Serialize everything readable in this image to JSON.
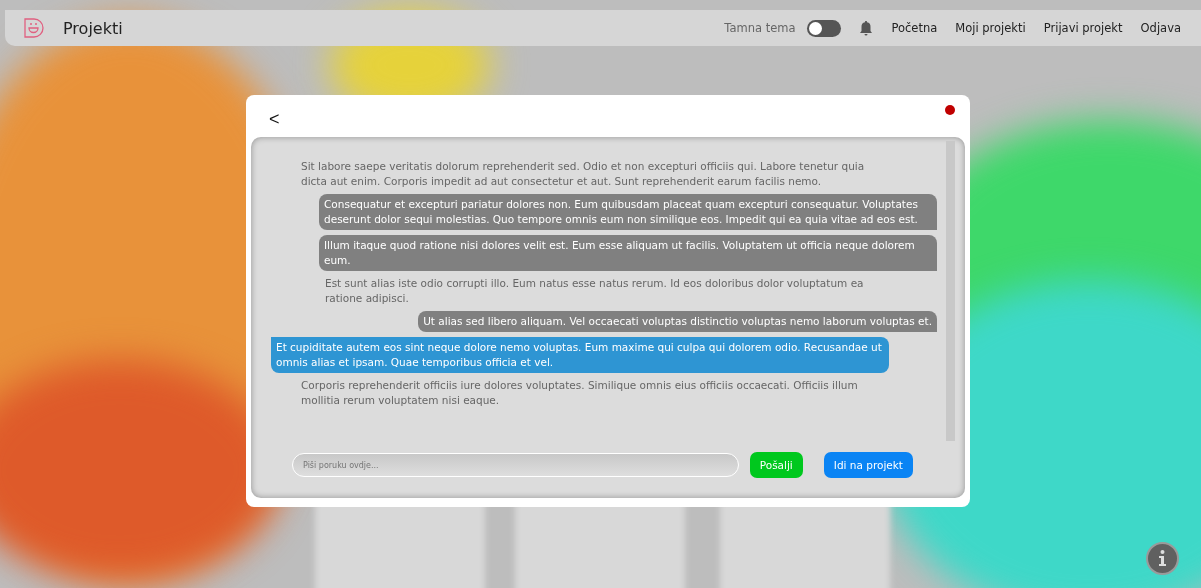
{
  "navbar": {
    "title": "Projekti",
    "theme_toggle": {
      "label": "Tamna tema",
      "on": false
    },
    "links": [
      "Početna",
      "Moji projekti",
      "Prijavi projekt",
      "Odjava"
    ]
  },
  "chat_dialog": {
    "back": "<",
    "messages": [
      {
        "kind": "note",
        "text": "Sit labore saepe veritatis dolorum reprehenderit sed. Odio et non excepturi officiis qui. Labore tenetur quia dicta aut enim. Corporis impedit ad aut consectetur et aut. Sunt reprehenderit earum facilis nemo."
      },
      {
        "kind": "outgoing",
        "text": "Consequatur et excepturi pariatur dolores non. Eum quibusdam placeat quam excepturi consequatur. Voluptates deserunt dolor sequi molestias. Quo tempore omnis eum non similique eos. Impedit qui ea quia vitae ad eos est."
      },
      {
        "kind": "outgoing",
        "text": "Illum itaque quod ratione nisi dolores velit est. Eum esse aliquam ut facilis. Voluptatem ut officia neque dolorem eum."
      },
      {
        "kind": "note",
        "text": "Est sunt alias iste odio corrupti illo. Eum natus esse natus rerum. Id eos doloribus dolor voluptatum ea ratione adipisci."
      },
      {
        "kind": "outgoing",
        "text": "Ut alias sed libero aliquam. Vel occaecati voluptas distinctio voluptas nemo laborum voluptas et."
      },
      {
        "kind": "incoming",
        "text": "Et cupiditate autem eos sint neque dolore nemo voluptas. Eum maxime qui culpa qui dolorem odio. Recusandae ut omnis alias et ipsam. Quae temporibus officia et vel."
      },
      {
        "kind": "note",
        "text": "Corporis reprehenderit officiis iure dolores voluptates. Similique omnis eius officiis occaecati. Officiis illum mollitia rerum voluptatem nisi eaque."
      }
    ],
    "message_input": {
      "placeholder": "Piši poruku ovdje..."
    },
    "send_button": "Pošalji",
    "project_button": "Idi na projekt"
  }
}
